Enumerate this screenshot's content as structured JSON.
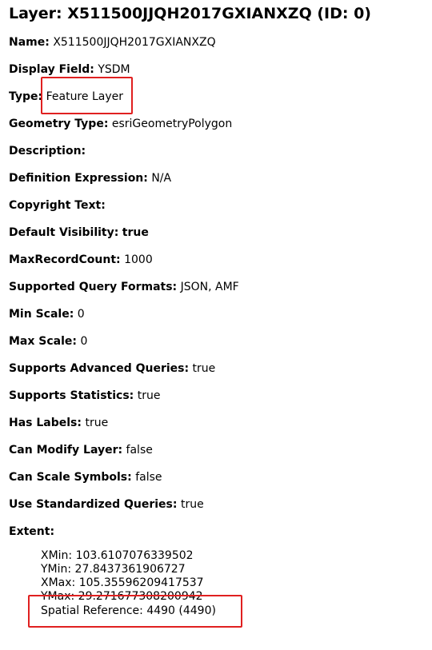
{
  "layer": {
    "title": "Layer: X511500JJQH2017GXIANXZQ (ID: 0)"
  },
  "fields": [
    {
      "label": "Name:",
      "value": "X511500JJQH2017GXIANXZQ"
    },
    {
      "label": "Display Field:",
      "value": "YSDM"
    },
    {
      "label": "Type:",
      "value": "Feature Layer"
    },
    {
      "label": "Geometry Type:",
      "value": "esriGeometryPolygon"
    },
    {
      "label": "Description:",
      "value": ""
    },
    {
      "label": "Definition Expression:",
      "value": "N/A"
    },
    {
      "label": "Copyright Text:",
      "value": ""
    },
    {
      "label": "Default Visibility:",
      "value": "true"
    },
    {
      "label": "MaxRecordCount:",
      "value": "1000"
    },
    {
      "label": "Supported Query Formats:",
      "value": "JSON, AMF"
    },
    {
      "label": "Min Scale:",
      "value": "0"
    },
    {
      "label": "Max Scale:",
      "value": "0"
    },
    {
      "label": "Supports Advanced Queries:",
      "value": "true"
    },
    {
      "label": "Supports Statistics:",
      "value": "true"
    },
    {
      "label": "Has Labels:",
      "value": "true"
    },
    {
      "label": "Can Modify Layer:",
      "value": "false"
    },
    {
      "label": "Can Scale Symbols:",
      "value": "false"
    },
    {
      "label": "Use Standardized Queries:",
      "value": "true"
    },
    {
      "label": "Extent:",
      "value": ""
    }
  ],
  "extent": {
    "xmin": "XMin: 103.6107076339502",
    "ymin": "YMin: 27.8437361906727",
    "xmax": "XMax: 105.35596209417537",
    "ymax": "YMax: 29.271677308200942",
    "spatial_reference": "Spatial Reference: 4490  (4490)"
  },
  "colors": {
    "highlight": "#e02020"
  }
}
